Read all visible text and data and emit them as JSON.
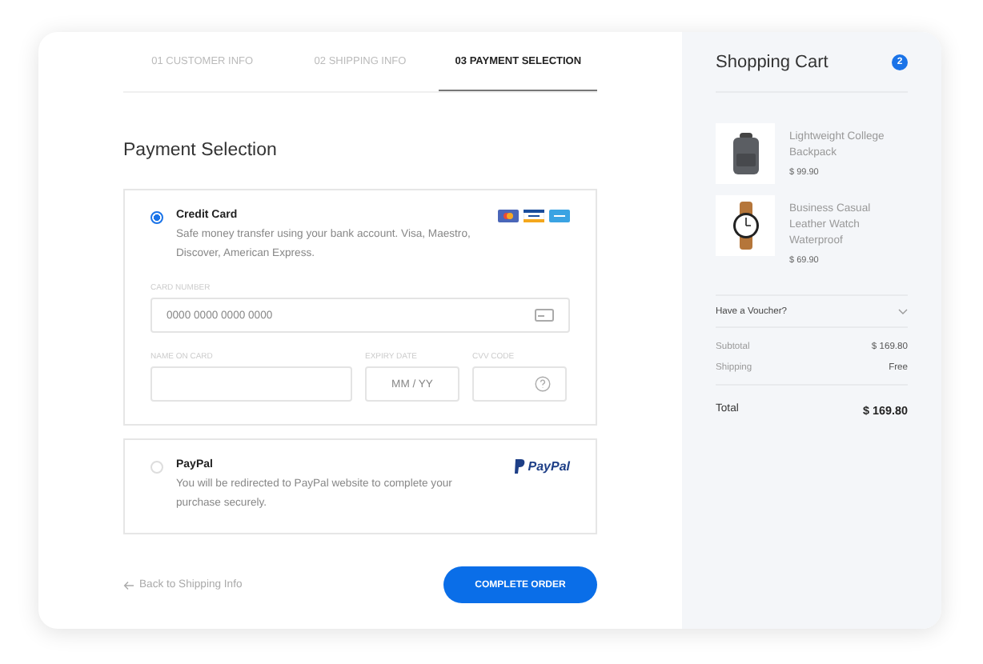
{
  "steps": [
    {
      "label": "01 CUSTOMER INFO",
      "selected": false
    },
    {
      "label": "02 SHIPPING INFO",
      "selected": false
    },
    {
      "label": "03 PAYMENT SELECTION",
      "selected": true
    }
  ],
  "heading": "Payment Selection",
  "payment_methods": [
    {
      "kind": "card",
      "title": "Credit Card",
      "description": "Safe money transfer using your bank account. Visa, Maestro, Discover, American Express.",
      "selected": true
    },
    {
      "kind": "paypal",
      "title": "PayPal",
      "description": "You will be redirected to PayPal website to complete your purchase securely.",
      "selected": false,
      "logo_text": "PayPal"
    }
  ],
  "card_form": {
    "card_number": {
      "label": "CARD NUMBER",
      "placeholder": "0000 0000 0000 0000"
    },
    "name_on_card": {
      "label": "NAME ON CARD"
    },
    "expiry": {
      "label": "EXPIRY DATE",
      "placeholder": "MM / YY"
    },
    "cvv": {
      "label": "CVV CODE"
    }
  },
  "back_link": "Back to Shipping Info",
  "submit_button": "COMPLETE ORDER",
  "cart": {
    "title": "Shopping Cart",
    "count": "2",
    "items": [
      {
        "kind": "backpack",
        "name": "Lightweight College Backpack",
        "price": "$ 99.90"
      },
      {
        "kind": "watch",
        "name": "Business Casual Leather Watch Waterproof",
        "price": "$ 69.90"
      }
    ],
    "voucher": "Have a Voucher?",
    "subtotal": {
      "label": "Subtotal",
      "value": "$ 169.80"
    },
    "shipping": {
      "label": "Shipping",
      "value": "Free"
    },
    "total": {
      "label": "Total",
      "value": "$ 169.80"
    }
  }
}
